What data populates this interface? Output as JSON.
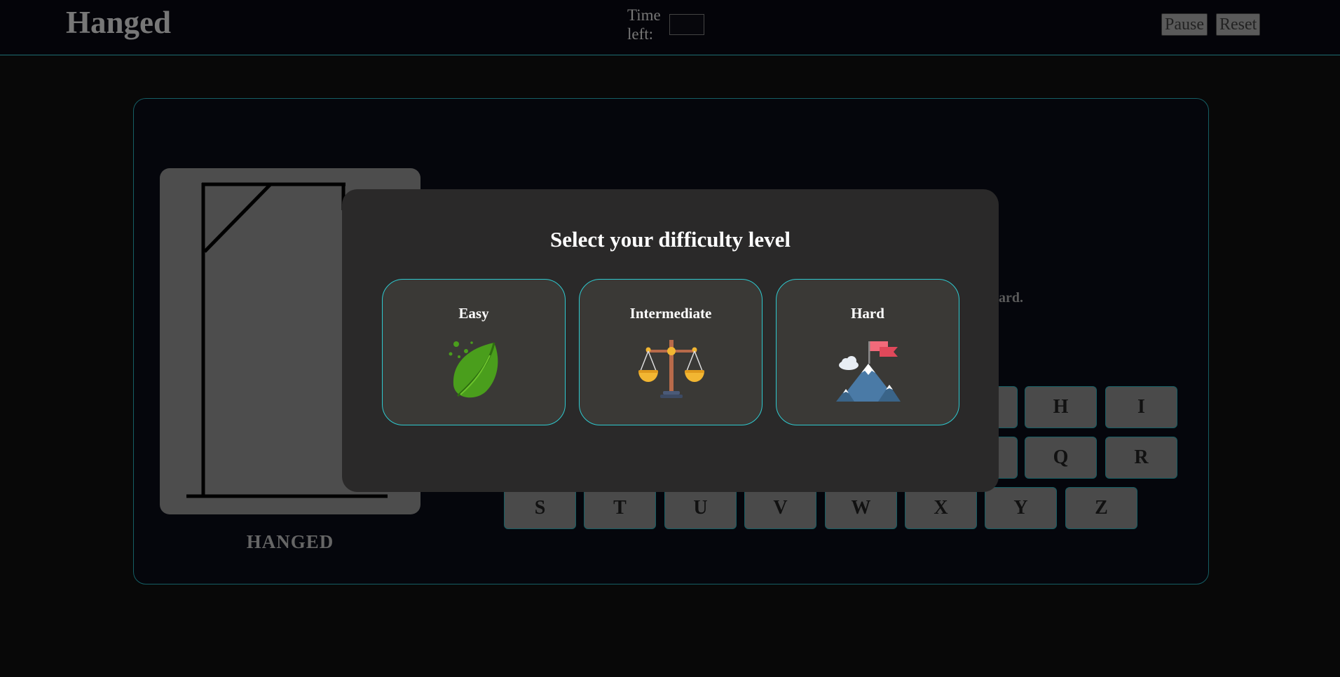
{
  "header": {
    "title": "Hanged",
    "timer_label": "Time left:",
    "timer_value": "",
    "pause_label": "Pause",
    "reset_label": "Reset"
  },
  "game": {
    "hanged_label": "HANGED",
    "hint_fragment": "ard.",
    "keyboard_visible": {
      "row1": [
        "H",
        "I"
      ],
      "row2": [
        "Q",
        "R"
      ],
      "row3": [
        "S",
        "T",
        "U",
        "V",
        "W",
        "X",
        "Y",
        "Z"
      ]
    }
  },
  "modal": {
    "title": "Select your difficulty level",
    "options": [
      {
        "label": "Easy",
        "icon": "leaf-icon"
      },
      {
        "label": "Intermediate",
        "icon": "balance-scale-icon"
      },
      {
        "label": "Hard",
        "icon": "mountain-flag-icon"
      }
    ]
  },
  "colors": {
    "accent": "#2ec9cf",
    "modal_bg": "#2a2929",
    "card_bg": "#3a3936"
  }
}
